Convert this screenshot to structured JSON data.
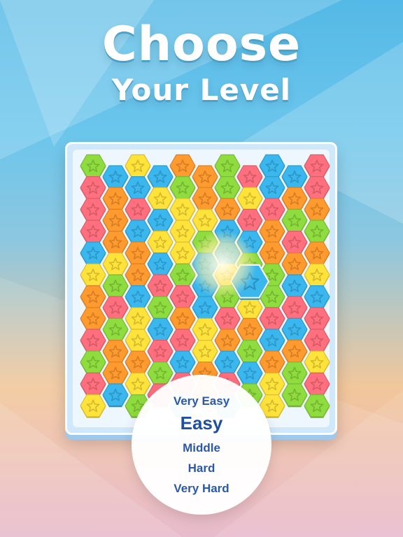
{
  "title": {
    "line1": "Choose",
    "line2": "Your Level"
  },
  "levels": {
    "very_easy": "Very Easy",
    "easy": "Easy",
    "middle": "Middle",
    "hard": "Hard",
    "very_hard": "Very Hard",
    "selected": "easy"
  },
  "colors": {
    "green": "#8fdc3e",
    "yellow": "#ffe23a",
    "orange": "#ff9a2e",
    "blue": "#39b7ee",
    "red": "#ff6f7e"
  },
  "tile_icon": "star-icon",
  "board": {
    "rows": [
      [
        "G",
        "Y",
        "O",
        "G",
        "B",
        "R"
      ],
      [
        "B",
        "B",
        "O",
        "R",
        "B"
      ],
      [
        "R",
        "B",
        "G",
        "G",
        "B",
        "R"
      ],
      [
        "O",
        "Y",
        "O",
        "Y",
        "O"
      ],
      [
        "R",
        "R",
        "Y",
        "O",
        "R",
        "O"
      ],
      [
        "O",
        "B",
        "Y",
        "R",
        "G"
      ],
      [
        "R",
        "B",
        "Y",
        "B",
        "O",
        "G"
      ],
      [
        "O",
        "Y",
        "G",
        "B",
        "R"
      ],
      [
        "B",
        "O",
        "Y",
        "B",
        "O",
        "O"
      ],
      [
        "Y",
        "B",
        "B",
        "G",
        "O"
      ],
      [
        "Y",
        "O",
        "G",
        "Y",
        "G",
        "Y"
      ],
      [
        "G",
        "R",
        "B",
        "O",
        "B"
      ],
      [
        "O",
        "B",
        "R",
        "G",
        "G",
        "B"
      ],
      [
        "R",
        "G",
        "B",
        "Y",
        "R"
      ],
      [
        "O",
        "Y",
        "O",
        "R",
        "R",
        "R"
      ],
      [
        "G",
        "B",
        "Y",
        "O",
        "B"
      ],
      [
        "R",
        "Y",
        "R",
        "O",
        "B",
        "R"
      ],
      [
        "O",
        "R",
        "Y",
        "G",
        "O"
      ],
      [
        "G",
        "O",
        "B",
        "B",
        "O",
        "Y"
      ],
      [
        "O",
        "G",
        "O",
        "B",
        "G"
      ],
      [
        "R",
        "Y",
        "R",
        "R",
        "Y",
        "R"
      ],
      [
        "B",
        "R",
        "O",
        "G",
        "G"
      ],
      [
        "Y",
        "G",
        "B",
        "B",
        "Y",
        "G"
      ]
    ],
    "selected_tile": {
      "row": 9,
      "col": 3,
      "color": "B"
    }
  }
}
